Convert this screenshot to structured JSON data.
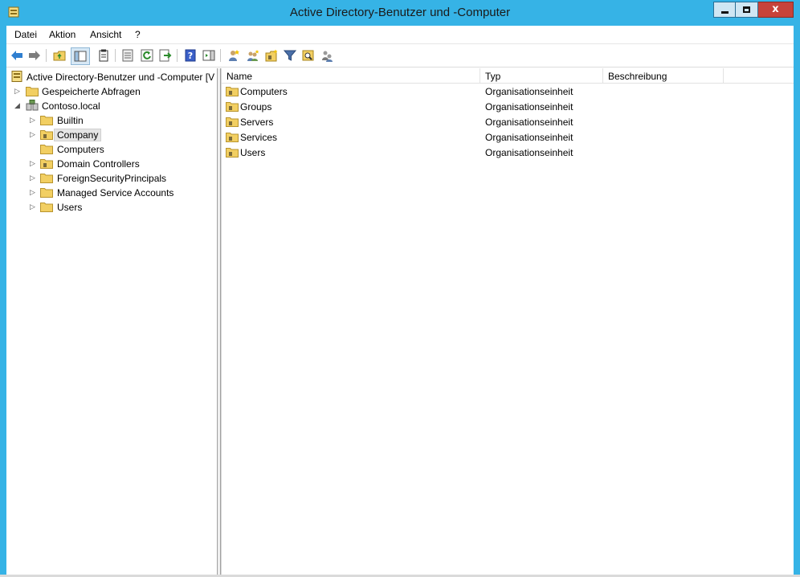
{
  "window": {
    "title": "Active Directory-Benutzer und -Computer",
    "close_glyph": "x"
  },
  "menu": {
    "items": [
      "Datei",
      "Aktion",
      "Ansicht",
      "?"
    ]
  },
  "toolbar": {
    "buttons": [
      "back-icon",
      "forward-icon",
      "up-folder-icon",
      "show-hide-console-tree-icon",
      "clipboard-icon",
      "properties-icon",
      "refresh-icon",
      "export-list-icon",
      "help-icon",
      "action-pane-icon",
      "new-user-icon",
      "new-group-icon",
      "new-ou-icon",
      "filter-icon",
      "find-icon",
      "add-to-group-icon"
    ]
  },
  "tree": {
    "root": "Active Directory-Benutzer und -Computer [V",
    "saved_queries": "Gespeicherte Abfragen",
    "domain": "Contoso.local",
    "children": [
      {
        "label": "Builtin",
        "expandable": true
      },
      {
        "label": "Company",
        "expandable": true,
        "selected": true
      },
      {
        "label": "Computers",
        "expandable": false
      },
      {
        "label": "Domain Controllers",
        "expandable": true
      },
      {
        "label": "ForeignSecurityPrincipals",
        "expandable": true
      },
      {
        "label": "Managed Service Accounts",
        "expandable": true
      },
      {
        "label": "Users",
        "expandable": true
      }
    ]
  },
  "list": {
    "columns": [
      "Name",
      "Typ",
      "Beschreibung"
    ],
    "rows": [
      {
        "name": "Computers",
        "type": "Organisationseinheit",
        "description": ""
      },
      {
        "name": "Groups",
        "type": "Organisationseinheit",
        "description": ""
      },
      {
        "name": "Servers",
        "type": "Organisationseinheit",
        "description": ""
      },
      {
        "name": "Services",
        "type": "Organisationseinheit",
        "description": ""
      },
      {
        "name": "Users",
        "type": "Organisationseinheit",
        "description": ""
      }
    ]
  },
  "colors": {
    "frame": "#36b3e6",
    "close_button": "#c7433a",
    "folder": "#f2cf62"
  }
}
